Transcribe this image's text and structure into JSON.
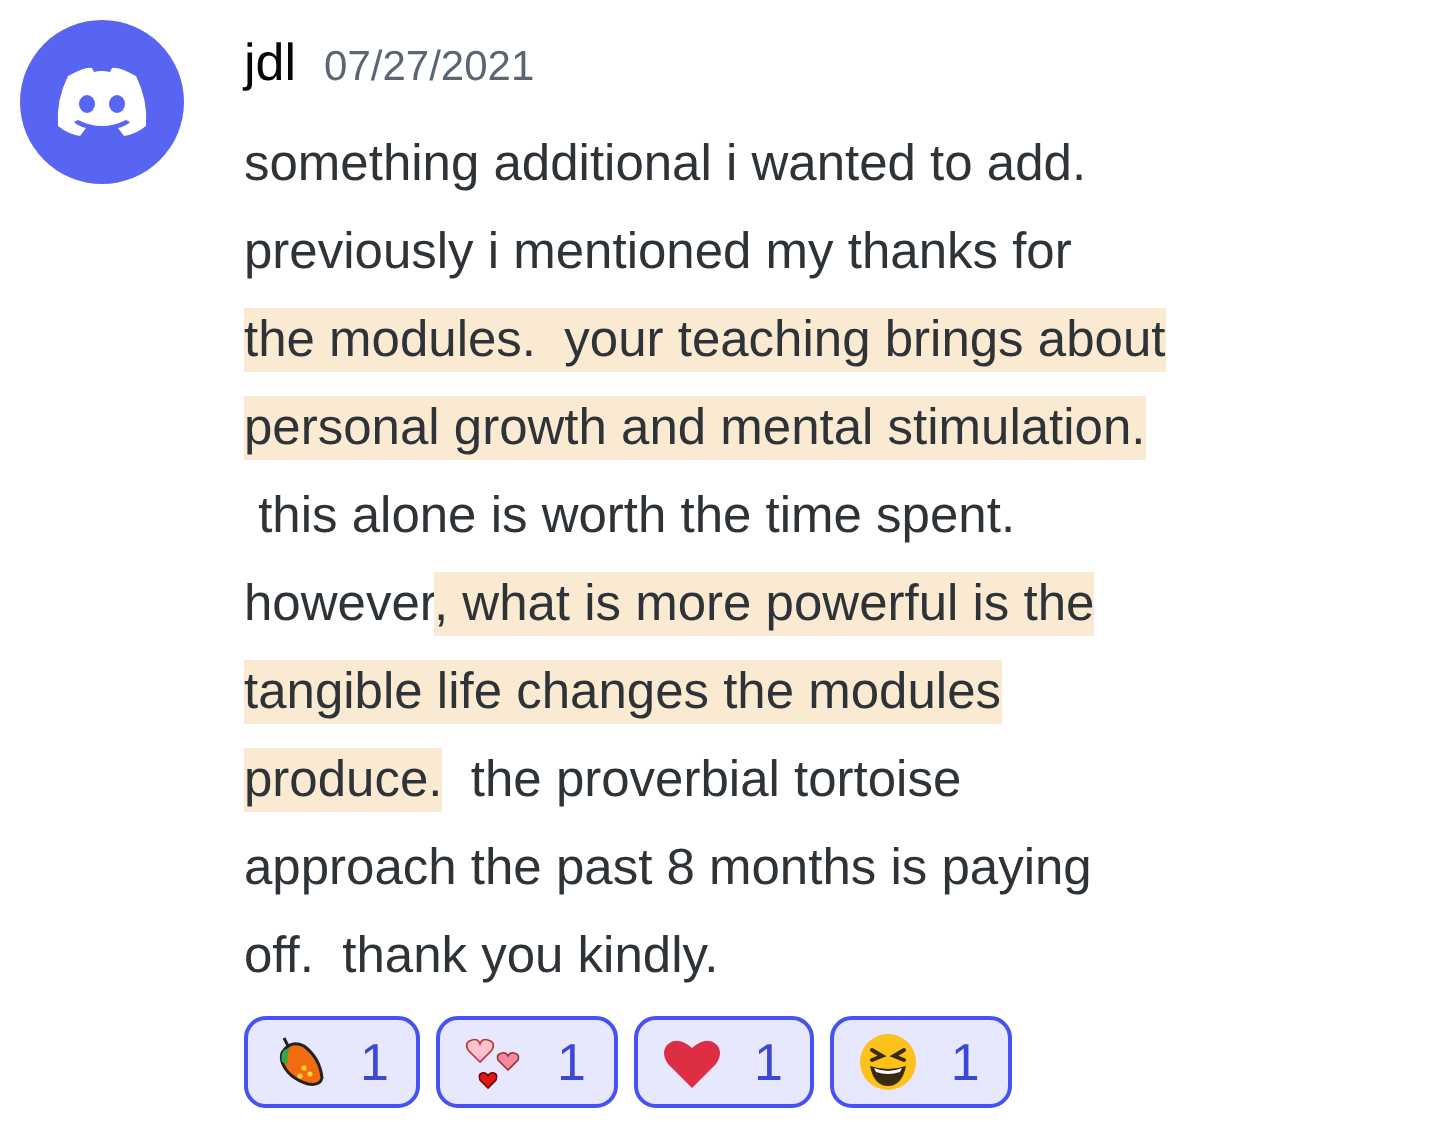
{
  "author": {
    "name": "jdl",
    "timestamp": "07/27/2021"
  },
  "message": {
    "lines": [
      [
        {
          "text": "something additional i wanted to add.",
          "highlighted": false
        }
      ],
      [
        {
          "text": "previously i mentioned my thanks for",
          "highlighted": false
        }
      ],
      [
        {
          "text": "the modules.  your teaching brings about",
          "highlighted": true
        }
      ],
      [
        {
          "text": "personal growth and mental stimulation.",
          "highlighted": true
        }
      ],
      [
        {
          "text": " this alone is worth the time spent.",
          "highlighted": false
        }
      ],
      [
        {
          "text": "however",
          "highlighted": false
        },
        {
          "text": ", what is more powerful is the",
          "highlighted": true
        }
      ],
      [
        {
          "text": "tangible life changes the modules",
          "highlighted": true
        }
      ],
      [
        {
          "text": "produce.",
          "highlighted": true
        },
        {
          "text": "  the proverbial tortoise",
          "highlighted": false
        }
      ],
      [
        {
          "text": "approach the past 8 months is paying",
          "highlighted": false
        }
      ],
      [
        {
          "text": "off.  thank you kindly.",
          "highlighted": false
        }
      ]
    ]
  },
  "reactions": [
    {
      "kind": "mango",
      "count": "1",
      "selected": true
    },
    {
      "kind": "hearts",
      "count": "1",
      "selected": true
    },
    {
      "kind": "heart",
      "count": "1",
      "selected": true
    },
    {
      "kind": "laugh",
      "count": "1",
      "selected": true
    }
  ]
}
